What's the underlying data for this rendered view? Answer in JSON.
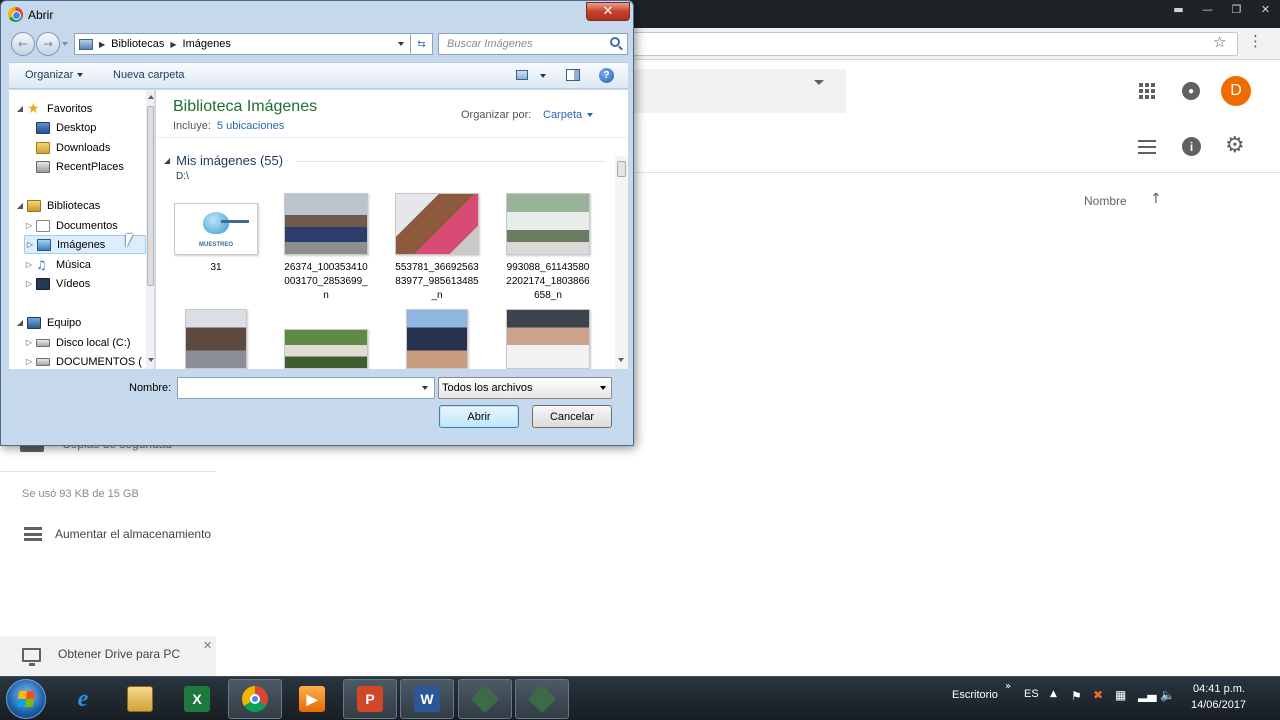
{
  "drive": {
    "avatar_letter": "D",
    "column_name": "Nombre",
    "backups_label": "Copias de seguridad",
    "storage_used": "Se usó 93 KB de 15 GB",
    "upgrade_storage": "Aumentar el almacenamiento",
    "get_drive_pc": "Obtener Drive para PC"
  },
  "dialog": {
    "title": "Abrir",
    "breadcrumb": [
      "Bibliotecas",
      "Imágenes"
    ],
    "search_placeholder": "Buscar Imágenes",
    "toolbar": {
      "organize": "Organizar",
      "new_folder": "Nueva carpeta"
    },
    "nav_tree": [
      {
        "label": "Favoritos",
        "icon": "star-icon",
        "level": 0,
        "arrow": "◢"
      },
      {
        "label": "Desktop",
        "icon": "desktop-icon",
        "level": 1,
        "arrow": ""
      },
      {
        "label": "Downloads",
        "icon": "downloads-folder-icon",
        "level": 1,
        "arrow": ""
      },
      {
        "label": "RecentPlaces",
        "icon": "recent-places-icon",
        "level": 1,
        "arrow": ""
      },
      {
        "label": "Bibliotecas",
        "icon": "libraries-icon",
        "level": 0,
        "arrow": "◢"
      },
      {
        "label": "Documentos",
        "icon": "documents-icon",
        "level": 1,
        "arrow": "▷"
      },
      {
        "label": "Imágenes",
        "icon": "pictures-icon",
        "level": 1,
        "arrow": "▷",
        "selected": true
      },
      {
        "label": "Música",
        "icon": "music-icon",
        "level": 1,
        "arrow": "▷"
      },
      {
        "label": "Vídeos",
        "icon": "videos-icon",
        "level": 1,
        "arrow": "▷"
      },
      {
        "label": "Equipo",
        "icon": "computer-icon",
        "level": 0,
        "arrow": "◢"
      },
      {
        "label": "Disco local (C:)",
        "icon": "disk-icon",
        "level": 1,
        "arrow": "▷"
      },
      {
        "label": "DOCUMENTOS (",
        "icon": "disk-icon",
        "level": 1,
        "arrow": "▷"
      }
    ],
    "library": {
      "title": "Biblioteca Imágenes",
      "includes_label": "Incluye:",
      "locations": "5 ubicaciones",
      "arrange_label": "Organizar por:",
      "arrange_value": "Carpeta"
    },
    "group": {
      "title": "Mis imágenes (55)",
      "path": "D:\\"
    },
    "thumbnails": [
      {
        "label": "31",
        "logo_text": "MUESTREO"
      },
      {
        "label": "26374_100353410003170_2853699_n"
      },
      {
        "label": "553781_3669256383977_985613485_n"
      },
      {
        "label": "993088_611435802202174_1803866658_n"
      },
      {
        "label": ""
      },
      {
        "label": ""
      },
      {
        "label": ""
      },
      {
        "label": ""
      }
    ],
    "filename_label": "Nombre:",
    "filename_value": "",
    "file_type": "Todos los archivos",
    "open_button": "Abrir",
    "cancel_button": "Cancelar"
  },
  "taskbar": {
    "desktop_label": "Escritorio",
    "language": "ES",
    "time": "04:41 p.m.",
    "date": "14/06/2017"
  }
}
